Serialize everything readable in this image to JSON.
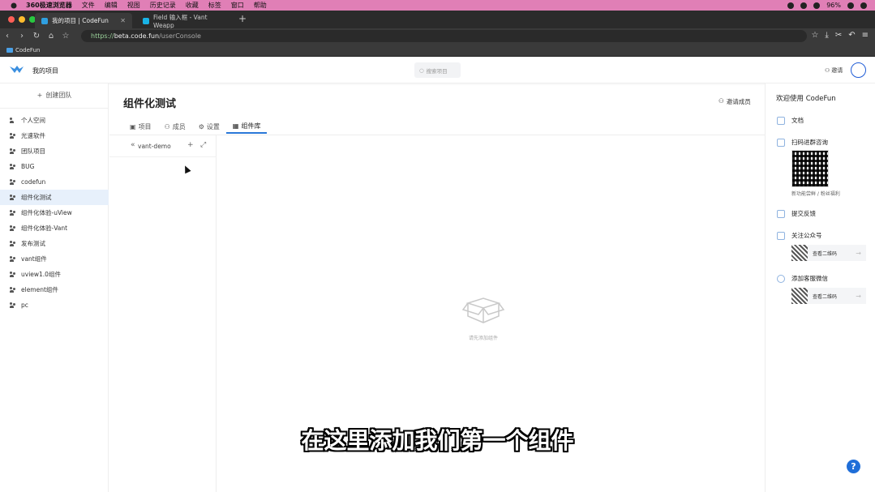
{
  "menubar": {
    "app": "360极速浏览器",
    "items": [
      "文件",
      "编辑",
      "视图",
      "历史记录",
      "收藏",
      "标签",
      "窗口",
      "帮助"
    ],
    "battery": "96%"
  },
  "browser": {
    "tabs": [
      {
        "title": "我的项目 | CodeFun"
      },
      {
        "title": "Field 输入框 - Vant Weapp"
      }
    ],
    "url_scheme": "https://",
    "url_host": "beta.code.fun",
    "url_path": "/userConsole",
    "bookmark": "CodeFun"
  },
  "header": {
    "title": "我的项目",
    "search_placeholder": "搜索项目",
    "invite": "邀请"
  },
  "sidebar": {
    "create": "创建团队",
    "items": [
      {
        "label": "个人空间"
      },
      {
        "label": "光速软件"
      },
      {
        "label": "团队项目"
      },
      {
        "label": "BUG"
      },
      {
        "label": "codefun"
      },
      {
        "label": "组件化测试"
      },
      {
        "label": "组件化体验-uView"
      },
      {
        "label": "组件化体验-Vant"
      },
      {
        "label": "发布测试"
      },
      {
        "label": "vant组件"
      },
      {
        "label": "uview1.0组件"
      },
      {
        "label": "element组件"
      },
      {
        "label": "pc"
      }
    ]
  },
  "main": {
    "title": "组件化测试",
    "invite_member": "邀请成员",
    "tabs": [
      {
        "label": "项目"
      },
      {
        "label": "成员"
      },
      {
        "label": "设置"
      },
      {
        "label": "组件库"
      }
    ],
    "lib_name": "vant-demo",
    "empty_text": "请先添加组件"
  },
  "right": {
    "welcome": "欢迎使用 CodeFun",
    "doc": "文档",
    "scan": "扫码进群咨询",
    "qr_note": "新功能尝鲜 / 粉丝福利",
    "feedback": "提交反馈",
    "follow": "关注公众号",
    "view_qr": "查看二维码",
    "add_service": "添加客服微信"
  },
  "subtitle": "在这里添加我们第一个组件",
  "help": "?"
}
